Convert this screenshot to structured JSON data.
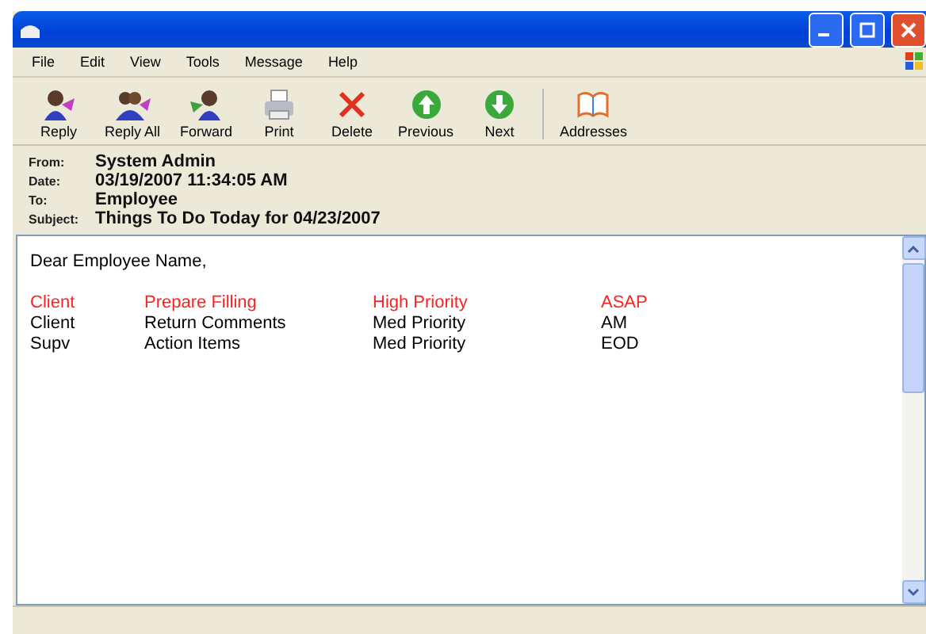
{
  "menu": [
    "File",
    "Edit",
    "View",
    "Tools",
    "Message",
    "Help"
  ],
  "toolbar": [
    {
      "kind": "reply",
      "label": "Reply"
    },
    {
      "kind": "reply-all",
      "label": "Reply All"
    },
    {
      "kind": "forward",
      "label": "Forward"
    },
    {
      "kind": "print",
      "label": "Print"
    },
    {
      "kind": "delete",
      "label": "Delete"
    },
    {
      "kind": "previous",
      "label": "Previous"
    },
    {
      "kind": "next",
      "label": "Next"
    },
    {
      "kind": "addresses",
      "label": "Addresses"
    }
  ],
  "headers": [
    {
      "label": "From:",
      "value": "System Admin"
    },
    {
      "label": "Date:",
      "value": "03/19/2007 11:34:05 AM"
    },
    {
      "label": "To:",
      "value": "Employee"
    },
    {
      "label": "Subject:",
      "value": "Things To Do Today for 04/23/2007"
    }
  ],
  "body": {
    "greeting": "Dear Employee Name,",
    "rows": [
      {
        "color": "#ff2020",
        "cells": [
          "Client",
          "Prepare Filling",
          "High Priority",
          "ASAP"
        ]
      },
      {
        "color": "#000000",
        "cells": [
          "Client",
          "Return Comments",
          "Med Priority",
          "AM"
        ]
      },
      {
        "color": "#000000",
        "cells": [
          "Supv",
          "Action Items",
          "Med Priority",
          "EOD"
        ]
      }
    ]
  }
}
